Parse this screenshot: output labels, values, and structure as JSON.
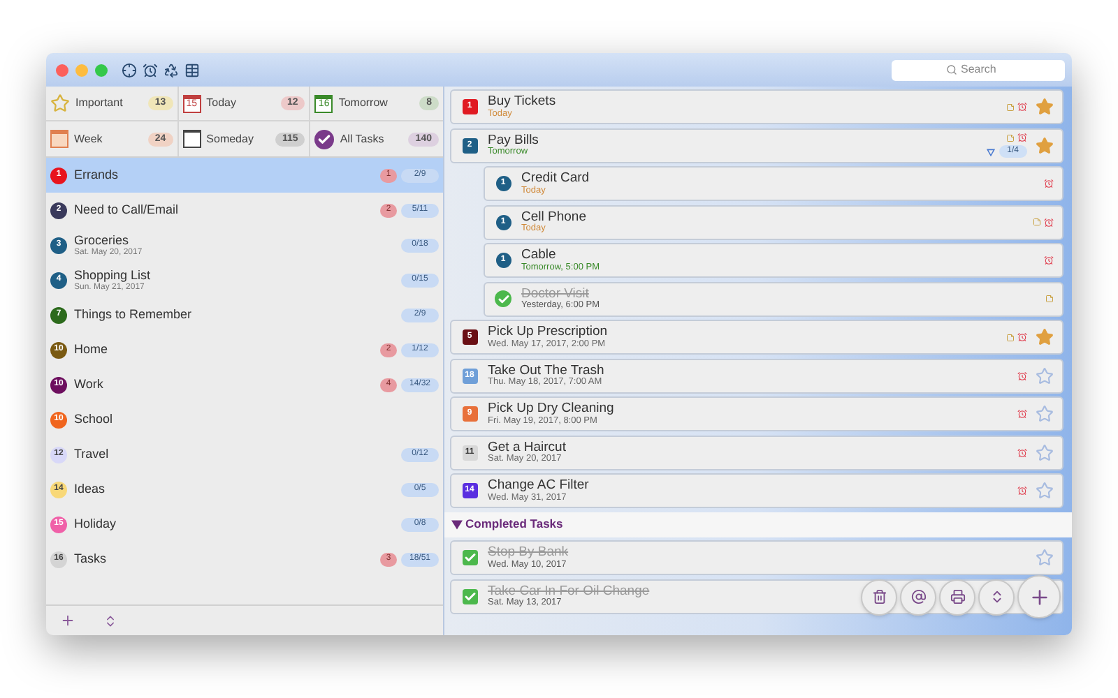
{
  "search": {
    "placeholder": "Search"
  },
  "filters": [
    {
      "kind": "star",
      "label": "Important",
      "count": "13",
      "color": "#f0e6b8"
    },
    {
      "kind": "calendar",
      "icon_text": "15",
      "label": "Today",
      "count": "12",
      "color": "#edc9c9"
    },
    {
      "kind": "calendar-green",
      "icon_text": "16",
      "label": "Tomorrow",
      "count": "8",
      "color": "#cddcc8"
    },
    {
      "kind": "week",
      "label": "Week",
      "count": "24",
      "color": "#f0d2c4"
    },
    {
      "kind": "someday",
      "label": "Someday",
      "count": "115",
      "color": "#cfcfcf"
    },
    {
      "kind": "check",
      "label": "All Tasks",
      "count": "140",
      "color": "#ddd0e0"
    }
  ],
  "lists": [
    {
      "number": "1",
      "name": "Errands",
      "color": "#e8141e",
      "overdue": "1",
      "progress": "2/9",
      "selected": true
    },
    {
      "number": "2",
      "name": "Need to Call/Email",
      "color": "#3a3a5c",
      "overdue": "2",
      "progress": "5/11",
      "selected": false
    },
    {
      "number": "3",
      "name": "Groceries",
      "date": "Sat. May 20, 2017",
      "color": "#1f5f86",
      "progress": "0/18",
      "selected": false
    },
    {
      "number": "4",
      "name": "Shopping List",
      "date": "Sun. May 21, 2017",
      "color": "#1f5f86",
      "progress": "0/15",
      "selected": false
    },
    {
      "number": "7",
      "name": "Things to Remember",
      "color": "#2c6a1c",
      "progress": "2/9",
      "selected": false
    },
    {
      "number": "10",
      "name": "Home",
      "color": "#7a5a12",
      "overdue": "2",
      "progress": "1/12",
      "selected": false
    },
    {
      "number": "10",
      "name": "Work",
      "color": "#6d0f5e",
      "overdue": "4",
      "progress": "14/32",
      "selected": false
    },
    {
      "number": "10",
      "name": "School",
      "color": "#f0651e",
      "selected": false
    },
    {
      "number": "12",
      "name": "Travel",
      "color": "#d8d8f8",
      "progress": "0/12",
      "selected": false
    },
    {
      "number": "14",
      "name": "Ideas",
      "color": "#f8d878",
      "progress": "0/5",
      "selected": false
    },
    {
      "number": "15",
      "name": "Holiday",
      "color": "#f060a8",
      "progress": "0/8",
      "selected": false
    },
    {
      "number": "16",
      "name": "Tasks",
      "color": "#d4d4d4",
      "overdue": "3",
      "progress": "18/51",
      "selected": false
    }
  ],
  "tasks": [
    {
      "priority": "1",
      "color": "#e01a22",
      "title": "Buy Tickets",
      "due": {
        "text": "Today",
        "color": "#d08a3a"
      },
      "starred": true,
      "completed": false,
      "alarm": true,
      "note": true
    },
    {
      "priority": "2",
      "color": "#1f5f86",
      "title": "Pay Bills",
      "due": {
        "text": "Tomorrow",
        "color": "#3a8a2a"
      },
      "starred": true,
      "completed": false,
      "alarm": true,
      "note": true,
      "progress": "1/4",
      "expanded": true,
      "children": [
        {
          "priority": "1",
          "color": "#1f5f86",
          "title": "Credit Card",
          "due": {
            "text": "Today",
            "color": "#d08a3a"
          },
          "completed": false,
          "alarm": true,
          "note": false
        },
        {
          "priority": "1",
          "color": "#1f5f86",
          "title": "Cell Phone",
          "due": {
            "text": "Today",
            "color": "#d08a3a"
          },
          "completed": false,
          "alarm": true,
          "note": true
        },
        {
          "priority": "1",
          "color": "#1f5f86",
          "title": "Cable",
          "due": {
            "text": "Tomorrow, 5:00 PM",
            "color": "#3a8a2a"
          },
          "completed": false,
          "alarm": true,
          "note": false
        },
        {
          "title": "Doctor Visit",
          "due": {
            "text": "Yesterday, 6:00 PM",
            "color": "#555555"
          },
          "completed": true,
          "alarm": false,
          "note": true
        }
      ]
    },
    {
      "priority": "5",
      "color": "#6a0f14",
      "title": "Pick Up Prescription",
      "due": {
        "text": "Wed. May 17, 2017, 2:00 PM",
        "color": "#666666"
      },
      "starred": true,
      "completed": false,
      "alarm": true,
      "note": true
    },
    {
      "priority": "18",
      "color": "#6f9fd8",
      "title": "Take Out The Trash",
      "due": {
        "text": "Thu. May 18, 2017, 7:00 AM",
        "color": "#666666"
      },
      "starred": false,
      "completed": false,
      "alarm": true,
      "note": false
    },
    {
      "priority": "9",
      "color": "#e8703a",
      "title": "Pick Up Dry Cleaning",
      "due": {
        "text": "Fri. May 19, 2017, 8:00 PM",
        "color": "#666666"
      },
      "starred": false,
      "completed": false,
      "alarm": true,
      "note": false
    },
    {
      "priority": "11",
      "color": "#d8d8d8",
      "title": "Get a Haircut",
      "due": {
        "text": "Sat. May 20, 2017",
        "color": "#666666"
      },
      "starred": false,
      "completed": false,
      "alarm": true,
      "note": false
    },
    {
      "priority": "14",
      "color": "#5a2ee0",
      "title": "Change AC Filter",
      "due": {
        "text": "Wed. May 31, 2017",
        "color": "#666666"
      },
      "starred": false,
      "completed": false,
      "alarm": true,
      "note": false
    }
  ],
  "completed_section": {
    "title": "Completed Tasks",
    "expanded": true,
    "tasks": [
      {
        "title": "Stop By Bank",
        "due": {
          "text": "Wed. May 10, 2017",
          "color": "#555555"
        },
        "starred": false,
        "completed": true
      },
      {
        "title": "Take Car In For Oil Change",
        "due": {
          "text": "Sat. May 13, 2017",
          "color": "#555555"
        },
        "completed": true
      }
    ]
  }
}
